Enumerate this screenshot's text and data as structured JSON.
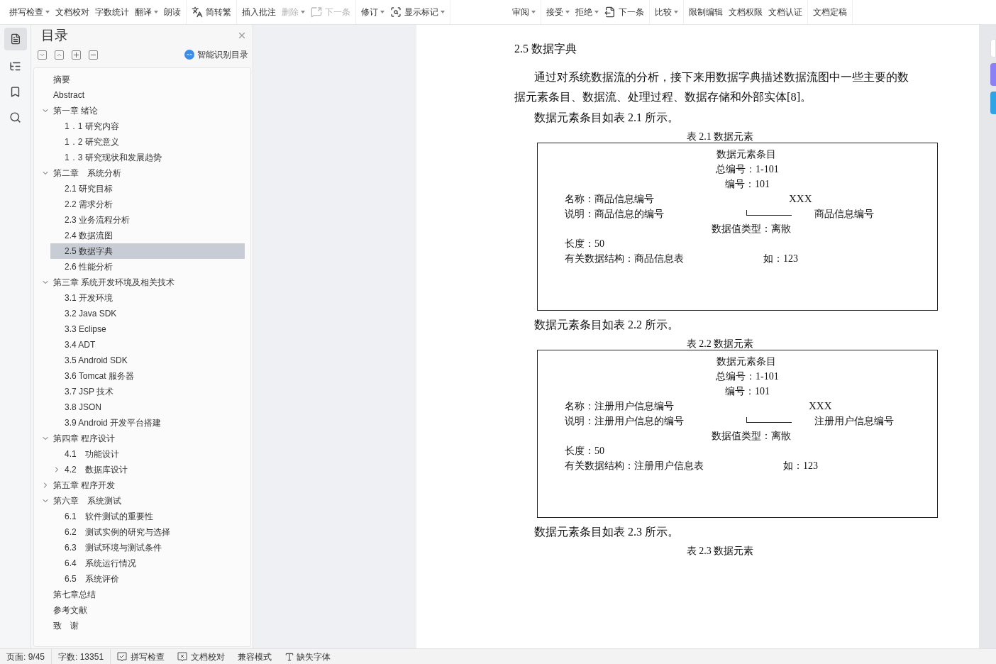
{
  "toolbar": {
    "groups": [
      [
        {
          "label": "拼写检查",
          "dropdown": true,
          "disabled": false,
          "kind": "text"
        },
        {
          "label": "文档校对",
          "dropdown": false,
          "disabled": false,
          "kind": "text"
        },
        {
          "label": "字数统计",
          "dropdown": false,
          "disabled": false,
          "kind": "text"
        },
        {
          "label": "翻译",
          "dropdown": true,
          "disabled": false,
          "kind": "text"
        },
        {
          "label": "朗读",
          "dropdown": false,
          "disabled": false,
          "kind": "text"
        }
      ],
      [
        {
          "label": "简转繁",
          "dropdown": false,
          "disabled": false,
          "kind": "convert"
        }
      ],
      [
        {
          "label": "插入批注",
          "dropdown": false,
          "disabled": false,
          "kind": "text"
        },
        {
          "label": "删除",
          "dropdown": true,
          "disabled": true,
          "kind": "text"
        },
        {
          "label": "下一条",
          "dropdown": false,
          "disabled": true,
          "kind": "comment"
        }
      ],
      [
        {
          "label": "修订",
          "dropdown": true,
          "disabled": false,
          "kind": "text"
        },
        {
          "label": "显示标记",
          "dropdown": true,
          "disabled": false,
          "kind": "markup"
        }
      ],
      [
        {
          "label": "审阅",
          "dropdown": true,
          "disabled": false,
          "kind": "text"
        }
      ],
      [
        {
          "label": "接受",
          "dropdown": true,
          "disabled": false,
          "kind": "text"
        },
        {
          "label": "拒绝",
          "dropdown": true,
          "disabled": false,
          "kind": "text"
        },
        {
          "label": "下一条",
          "dropdown": false,
          "disabled": false,
          "kind": "next"
        }
      ],
      [
        {
          "label": "比较",
          "dropdown": true,
          "disabled": false,
          "kind": "text"
        }
      ],
      [
        {
          "label": "限制编辑",
          "dropdown": false,
          "disabled": false,
          "kind": "text"
        },
        {
          "label": "文档权限",
          "dropdown": false,
          "disabled": false,
          "kind": "text"
        },
        {
          "label": "文档认证",
          "dropdown": false,
          "disabled": false,
          "kind": "text"
        }
      ],
      [
        {
          "label": "文档定稿",
          "dropdown": false,
          "disabled": false,
          "kind": "text"
        }
      ]
    ]
  },
  "sidebar": {
    "title": "目录",
    "smart_button": "智能识别目录",
    "toc": [
      {
        "label": "摘要",
        "selected": false
      },
      {
        "label": "Abstract",
        "selected": false
      },
      {
        "label": "第一章 绪论",
        "selected": false,
        "expanded": true,
        "children": [
          {
            "label": "1．1 研究内容",
            "selected": false
          },
          {
            "label": "1．2 研究意义",
            "selected": false
          },
          {
            "label": "1．3 研究现状和发展趋势",
            "selected": false
          }
        ]
      },
      {
        "label": "第二章　系统分析",
        "selected": false,
        "expanded": true,
        "children": [
          {
            "label": "2.1 研究目标",
            "selected": false
          },
          {
            "label": "2.2 需求分析",
            "selected": false
          },
          {
            "label": "2.3 业务流程分析",
            "selected": false
          },
          {
            "label": "2.4 数据流图",
            "selected": false
          },
          {
            "label": "2.5 数据字典",
            "selected": true
          },
          {
            "label": "2.6 性能分析",
            "selected": false
          }
        ]
      },
      {
        "label": "第三章 系统开发环境及相关技术",
        "selected": false,
        "expanded": true,
        "children": [
          {
            "label": "3.1 开发环境",
            "selected": false
          },
          {
            "label": "3.2 Java SDK",
            "selected": false
          },
          {
            "label": "3.3 Eclipse",
            "selected": false
          },
          {
            "label": "3.4 ADT",
            "selected": false
          },
          {
            "label": "3.5 Android SDK",
            "selected": false
          },
          {
            "label": "3.6 Tomcat 服务器",
            "selected": false
          },
          {
            "label": "3.7 JSP 技术",
            "selected": false
          },
          {
            "label": "3.8 JSON",
            "selected": false
          },
          {
            "label": "3.9 Android 开发平台搭建",
            "selected": false
          }
        ]
      },
      {
        "label": "第四章 程序设计",
        "selected": false,
        "expanded": true,
        "children": [
          {
            "label": "4.1　功能设计",
            "selected": false
          },
          {
            "label": "4.2　数据库设计",
            "selected": false,
            "expanded": false
          }
        ]
      },
      {
        "label": "第五章 程序开发",
        "selected": false,
        "expanded": false
      },
      {
        "label": "第六章　系统测试",
        "selected": false,
        "expanded": true,
        "children": [
          {
            "label": "6.1　软件测试的重要性",
            "selected": false
          },
          {
            "label": "6.2　测试实例的研究与选择",
            "selected": false
          },
          {
            "label": "6.3　测试环境与测试条件",
            "selected": false
          },
          {
            "label": "6.4　系统运行情况",
            "selected": false
          },
          {
            "label": "6.5　系统评价",
            "selected": false
          }
        ]
      },
      {
        "label": "第七章总结",
        "selected": false
      },
      {
        "label": "参考文献",
        "selected": false
      },
      {
        "label": "致　谢",
        "selected": false
      }
    ]
  },
  "document": {
    "blocks": [
      {
        "kind": "heading",
        "text": "2.5 数据字典"
      },
      {
        "kind": "paragraph",
        "text": "通过对系统数据流的分析，接下来用数据字典描述数据流图中一些主要的数据元素条目、数据流、处理过程、数据存储和外部实体[8]。"
      },
      {
        "kind": "line",
        "text": "数据元素条目如表 2.1 所示。"
      },
      {
        "kind": "caption",
        "text": "表 2.1 数据元素"
      },
      {
        "kind": "table",
        "title": "数据元素条目",
        "total_no": "总编号：1-101",
        "no": "编号：101",
        "name": "名称：商品信息编号",
        "code": "XXX",
        "description": "说明：商品信息的编号",
        "target": "商品信息编号",
        "value_type": "数据值类型：离散",
        "length": "长度：50",
        "structure": "有关数据结构：商品信息表",
        "example": "如：123"
      },
      {
        "kind": "line",
        "text": "数据元素条目如表 2.2 所示。"
      },
      {
        "kind": "caption",
        "text": "表 2.2 数据元素"
      },
      {
        "kind": "table",
        "title": "数据元素条目",
        "total_no": "总编号：1-101",
        "no": "编号：101",
        "name": "名称：注册用户信息编号",
        "code": "XXX",
        "description": "说明：注册用户信息的编号",
        "target": "注册用户信息编号",
        "value_type": "数据值类型：离散",
        "length": "长度：50",
        "structure": "有关数据结构：注册用户信息表",
        "example": "如：123"
      },
      {
        "kind": "line",
        "text": "数据元素条目如表 2.3 所示。"
      },
      {
        "kind": "caption",
        "text": "表 2.3 数据元素"
      }
    ]
  },
  "status_bar": [
    {
      "kind": "text",
      "label": "页面: 9/45"
    },
    {
      "kind": "text",
      "label": "字数: 13351"
    },
    {
      "kind": "spell",
      "label": "拼写检查"
    },
    {
      "kind": "proof",
      "label": "文档校对"
    },
    {
      "kind": "plain",
      "label": "兼容模式"
    },
    {
      "kind": "font",
      "label": "缺失字体"
    }
  ]
}
